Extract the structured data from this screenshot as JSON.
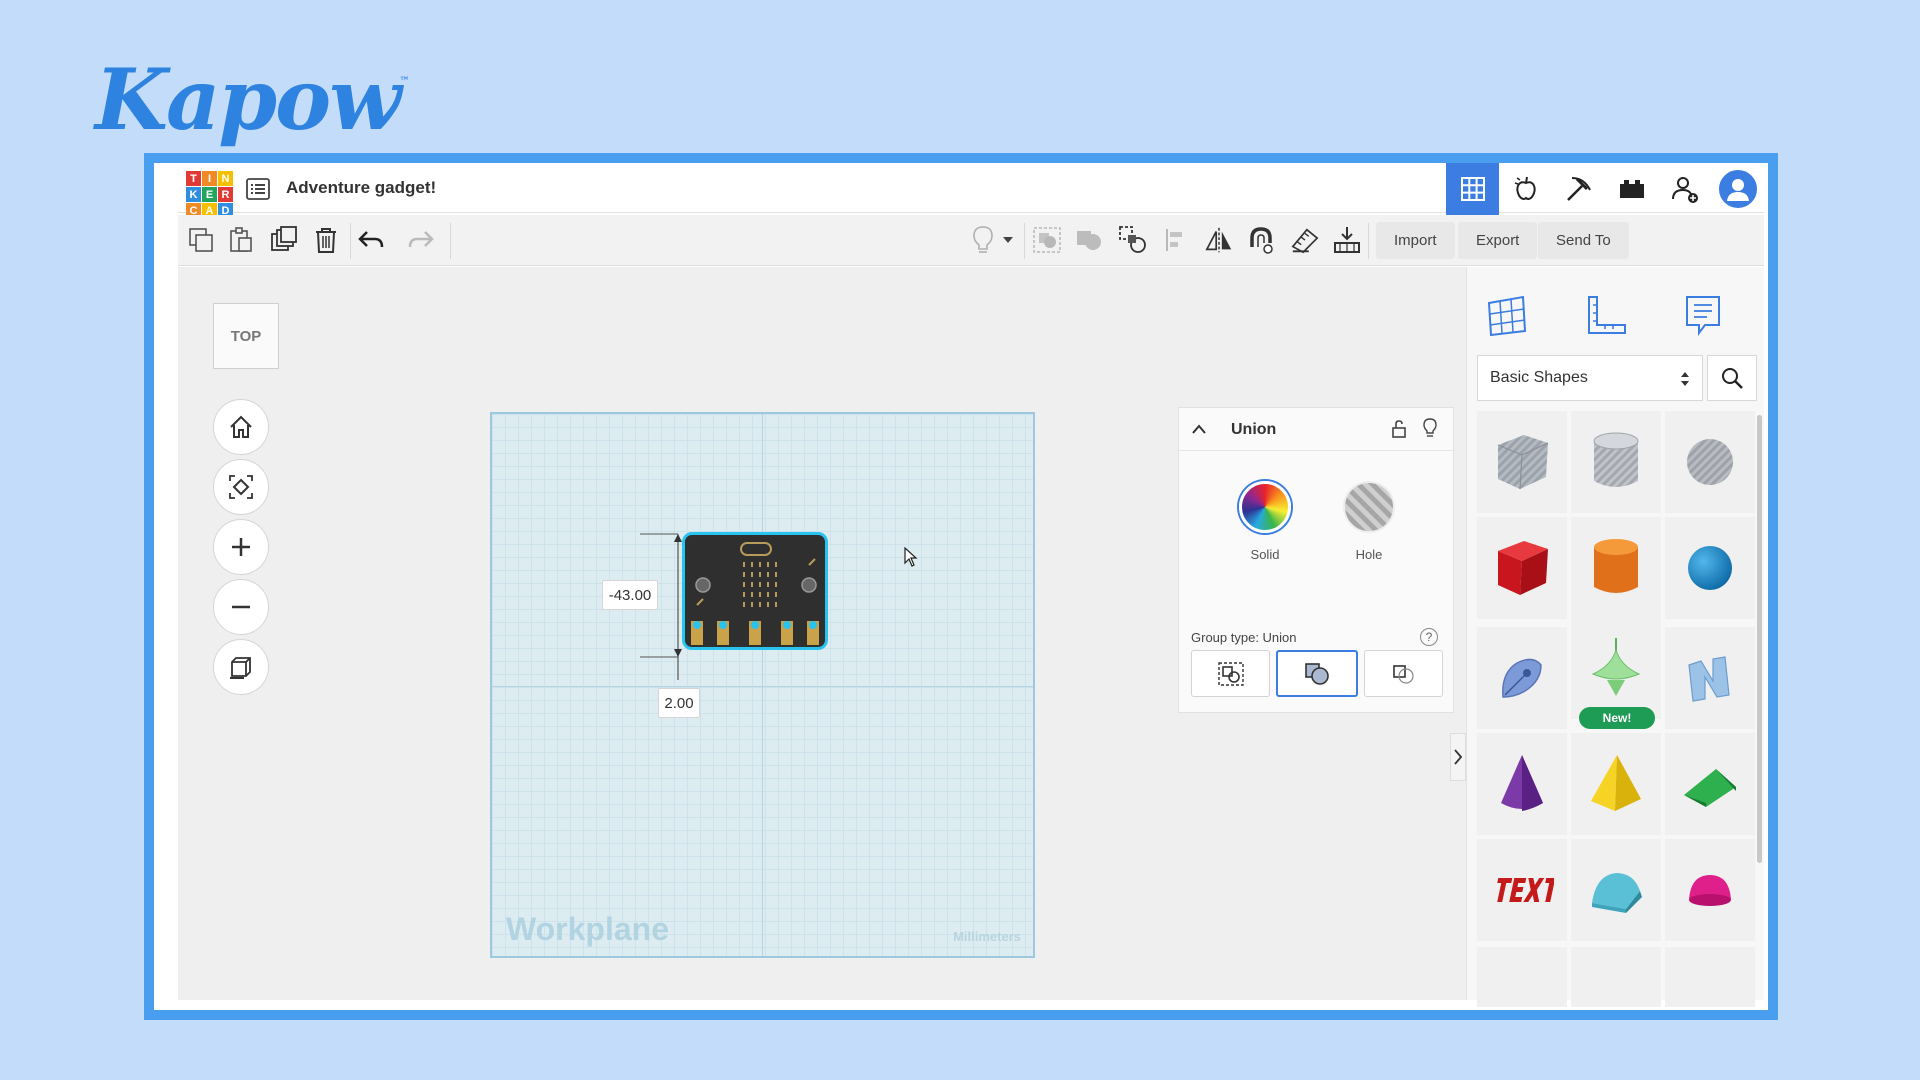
{
  "brand": {
    "name": "Kapow",
    "tm": "™"
  },
  "app": {
    "logo_letters": [
      "T",
      "I",
      "N",
      "K",
      "E",
      "R",
      "C",
      "A",
      "D"
    ],
    "logo_colors": [
      "#e13a36",
      "#f08a24",
      "#f6c000",
      "#2f8ee0",
      "#23a45c",
      "#e13a36",
      "#f08a24",
      "#f6c000",
      "#2f8ee0"
    ],
    "doc_title": "Adventure gadget!"
  },
  "toolbar": {
    "import_label": "Import",
    "export_label": "Export",
    "send_label": "Send To"
  },
  "canvas": {
    "view_label": "TOP",
    "workplane_label": "Workplane",
    "units_label": "Millimeters",
    "dim_y": "-43.00",
    "dim_x": "2.00"
  },
  "inspector": {
    "title": "Union",
    "solid_label": "Solid",
    "hole_label": "Hole",
    "group_type_label": "Group type: Union",
    "help_glyph": "?"
  },
  "library": {
    "category": "Basic Shapes",
    "new_badge": "New!",
    "shapes": [
      {
        "name": "box-striped",
        "color": "#a8aeb6"
      },
      {
        "name": "cylinder-striped",
        "color": "#b0b5bd"
      },
      {
        "name": "sphere-striped",
        "color": "#a5aab2"
      },
      {
        "name": "box",
        "color": "#d4202a"
      },
      {
        "name": "cylinder",
        "color": "#e8771e"
      },
      {
        "name": "sphere",
        "color": "#1e8ccc"
      },
      {
        "name": "scribble",
        "color": "#7d9ad8"
      },
      {
        "name": "spinning-top",
        "color": "#8ed88e"
      },
      {
        "name": "text-3d-n",
        "color": "#8eb6e0"
      },
      {
        "name": "cone",
        "color": "#7b3aa8"
      },
      {
        "name": "pyramid",
        "color": "#f1cf1a"
      },
      {
        "name": "wedge",
        "color": "#1e9c3e"
      },
      {
        "name": "text",
        "color": "#c41a1a"
      },
      {
        "name": "half-cylinder",
        "color": "#4fb2c8"
      },
      {
        "name": "paraboloid",
        "color": "#e0208a"
      }
    ]
  },
  "colors": {
    "accent": "#3b7de0",
    "frame": "#4a9ef0",
    "background": "#c2dcfa",
    "selection": "#29c3ef"
  }
}
